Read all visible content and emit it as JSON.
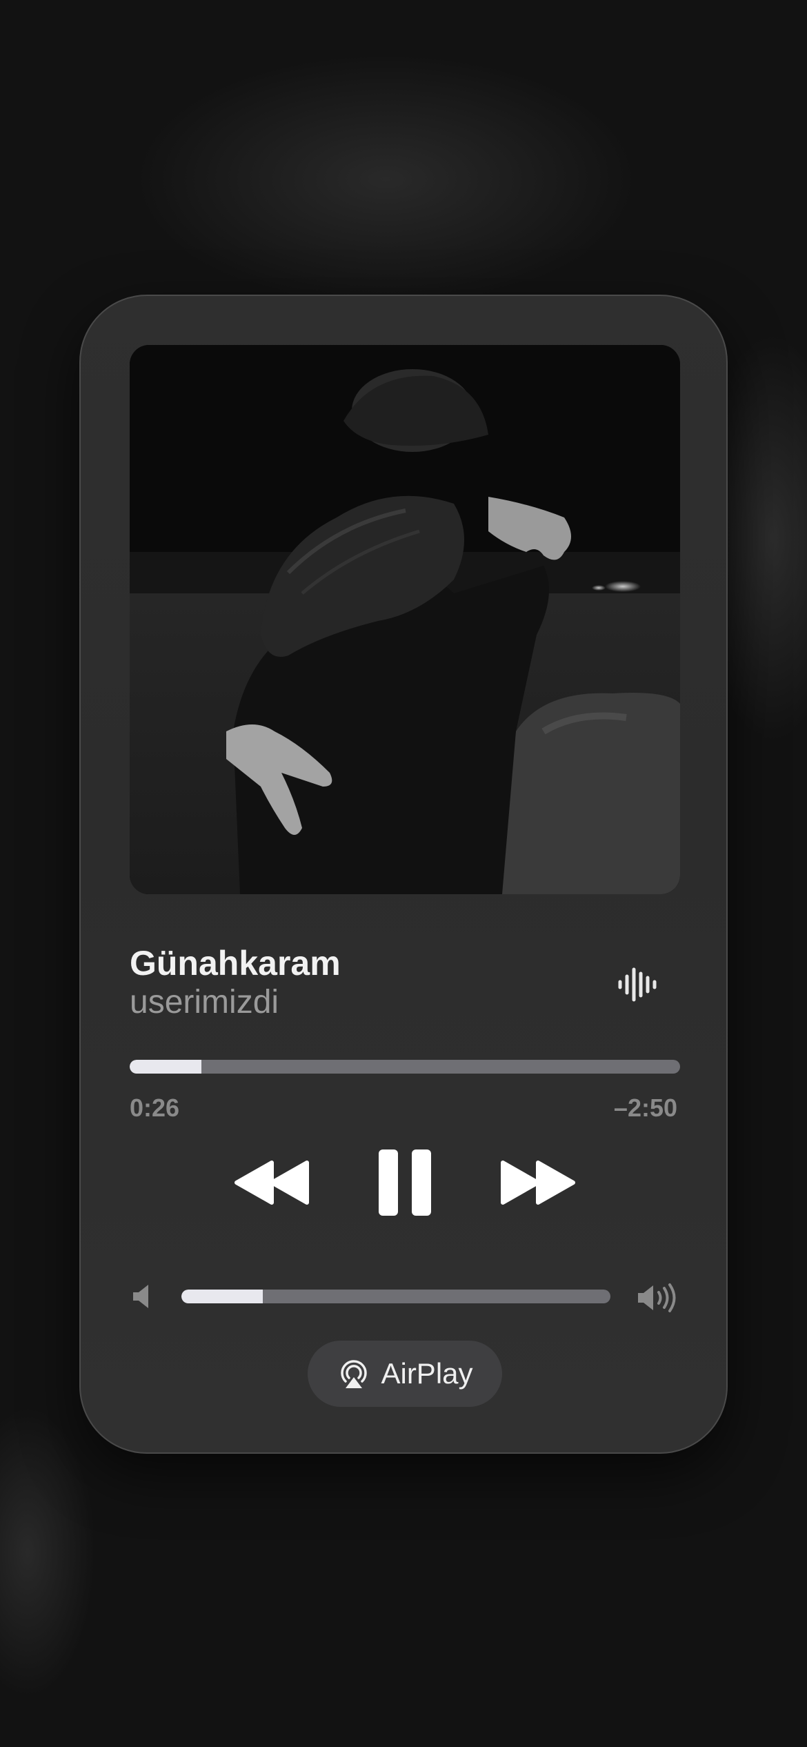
{
  "track": {
    "title": "Günahkaram",
    "artist": "userimizdi"
  },
  "playback": {
    "elapsed": "0:26",
    "remaining": "–2:50",
    "progress_fraction": 0.13,
    "state": "playing"
  },
  "volume": {
    "level_fraction": 0.19
  },
  "airplay": {
    "label": "AirPlay"
  },
  "icons": {
    "waveform": "waveform-icon",
    "rewind": "rewind-icon",
    "pause": "pause-icon",
    "forward": "fast-forward-icon",
    "volume_low": "speaker-low-icon",
    "volume_high": "speaker-high-icon",
    "airplay": "airplay-icon"
  },
  "colors": {
    "background": "#121212",
    "card": "#2e2e2e",
    "track_fill": "#e8e8ee",
    "track_empty": "#6f6f74",
    "title": "#f2f2f2",
    "secondary": "#9a9a9a"
  }
}
